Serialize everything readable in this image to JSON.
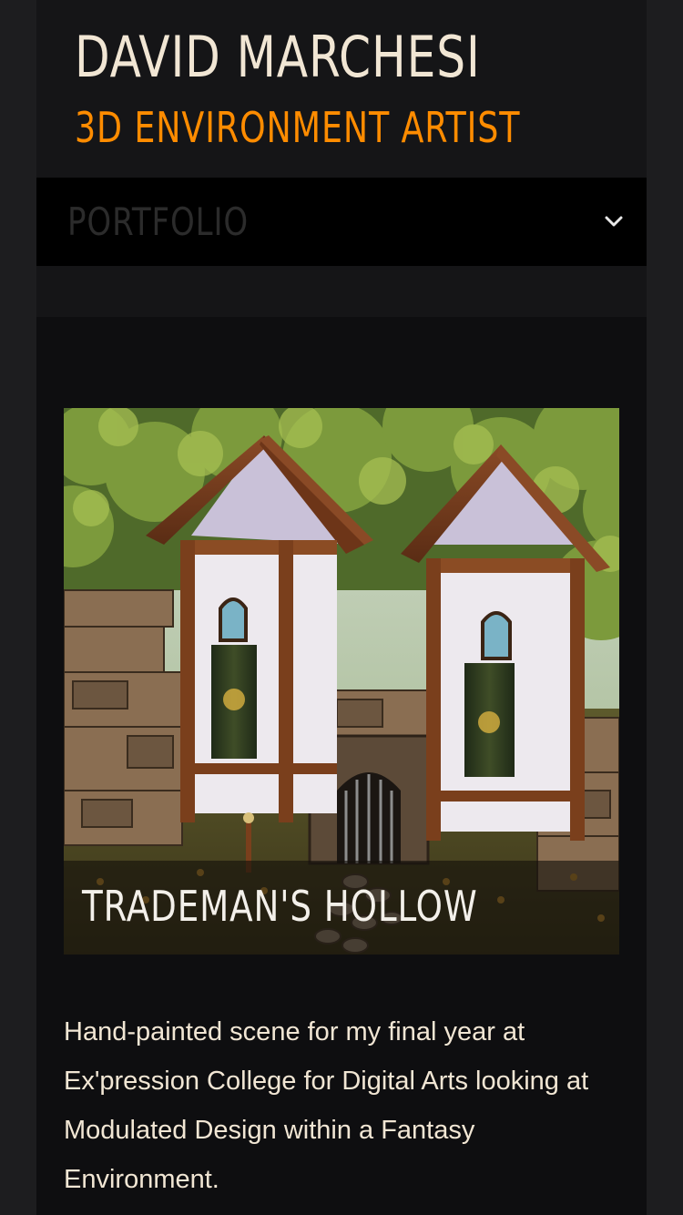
{
  "header": {
    "name": "DAVID MARCHESI",
    "role": "3D ENVIRONMENT ARTIST"
  },
  "nav": {
    "current": "PORTFOLIO",
    "toggle_icon": "chevron-down-icon"
  },
  "project": {
    "title": "TRADEMAN'S HOLLOW",
    "description": "Hand-painted scene for my final year at Ex'pression College for Digital Arts looking at Modulated Design within a Fantasy Environment."
  },
  "colors": {
    "accent": "#ff8c00",
    "heading": "#f1e6d4",
    "background": "#151517",
    "nav_background": "#000000"
  }
}
